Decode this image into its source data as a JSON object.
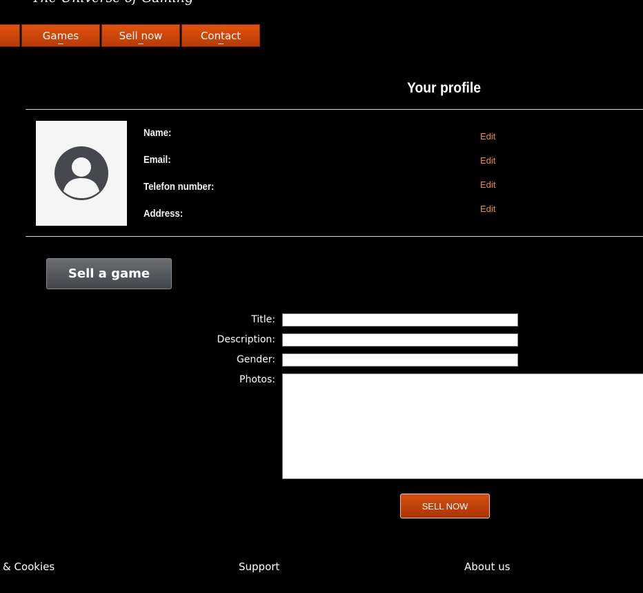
{
  "header": {
    "tagline": "The Universe of Gaming"
  },
  "nav": {
    "items": [
      {
        "label": ""
      },
      {
        "label": "Games"
      },
      {
        "label": "Sell now"
      },
      {
        "label": "Contact"
      }
    ]
  },
  "profile": {
    "heading": "Your profile",
    "avatar_icon": "user-avatar-icon",
    "fields": [
      {
        "label": "Name:",
        "edit": "Edit"
      },
      {
        "label": "Email:",
        "edit": "Edit"
      },
      {
        "label": "Telefon number:",
        "edit": "Edit"
      },
      {
        "label": "Address:",
        "edit": "Edit"
      }
    ]
  },
  "sell": {
    "toggle_label": "Sell a game",
    "form": {
      "title_label": "Title:",
      "description_label": "Description:",
      "gender_label": "Gender:",
      "photos_label": "Photos:",
      "title_value": "",
      "description_value": "",
      "gender_value": "",
      "submit_label": "SELL NOW"
    }
  },
  "footer": {
    "links": [
      {
        "label": "& Cookies"
      },
      {
        "label": "Support"
      },
      {
        "label": "About us"
      }
    ]
  },
  "colors": {
    "background": "#000000",
    "nav_orange": "#d14a0b",
    "edit_link": "#f08a2d",
    "button_gray": "#55585c"
  }
}
